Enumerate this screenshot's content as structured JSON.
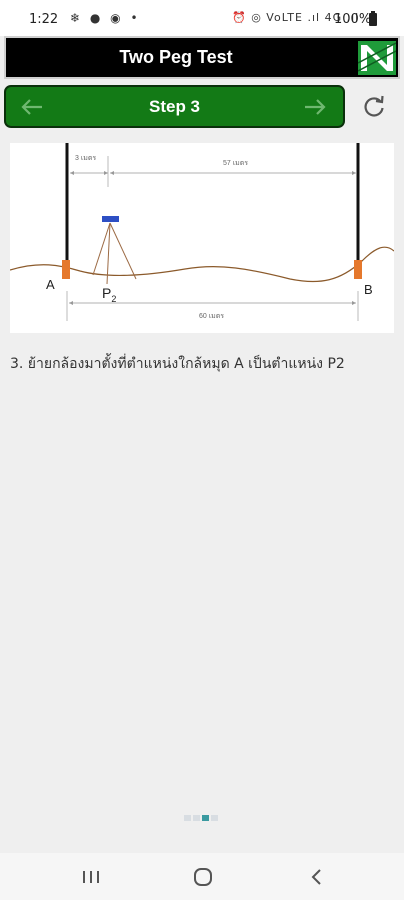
{
  "status_bar": {
    "time": "1:22",
    "left_icons": [
      "snowflake-icon",
      "facebook-icon",
      "chat-icon",
      "dot-icon"
    ],
    "right_icons_text": "⏰ ◎ VoLTE .ıl 4G .ıl",
    "battery": "100%"
  },
  "header": {
    "title": "Two Peg Test",
    "logo_icon": "app-logo-icon",
    "colors": {
      "background": "#000000",
      "logo_green": "#1f9b3a"
    }
  },
  "step_nav": {
    "title": "Step 3",
    "prev_icon": "arrow-left-icon",
    "next_icon": "arrow-right-icon",
    "refresh_icon": "refresh-icon",
    "colors": {
      "background": "#137a16"
    }
  },
  "diagram": {
    "label_a": "A",
    "label_b": "B",
    "label_p": "P",
    "label_p_sub": "2",
    "dist_1": "3 เมตร",
    "dist_2": "57 เมตร",
    "dist_total": "60 เมตร"
  },
  "instruction": "3. ย้ายกล้องมาตั้งที่ตำแหน่งใกล้หมุด A เป็นตำแหน่ง P2",
  "pager": {
    "count": 4,
    "active_index": 2
  },
  "nav_bar": {
    "icons": [
      "recents-icon",
      "home-icon",
      "back-icon"
    ]
  }
}
